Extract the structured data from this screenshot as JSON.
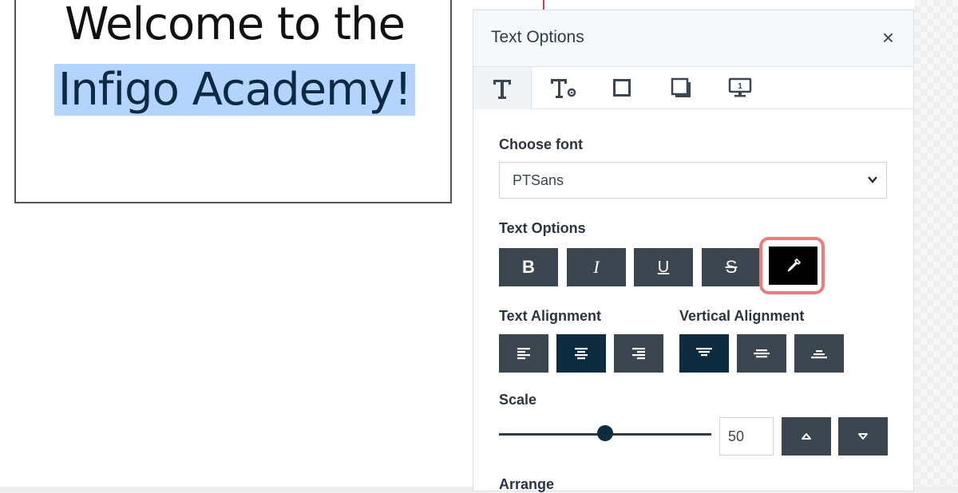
{
  "canvas": {
    "line1": "Welcome to the",
    "line2": "Infigo Academy!"
  },
  "panel": {
    "title": "Text Options",
    "close_label": "×",
    "tabs": [
      {
        "icon": "text-icon"
      },
      {
        "icon": "text-settings-icon"
      },
      {
        "icon": "border-box-icon"
      },
      {
        "icon": "shadow-box-icon"
      },
      {
        "icon": "monitor-icon",
        "badge": "1"
      }
    ],
    "font": {
      "label": "Choose font",
      "selected": "PTSans"
    },
    "text_options": {
      "label": "Text Options",
      "bold": "B",
      "italic": "I",
      "underline": "U",
      "strike": "S",
      "color_icon": "eyedropper-icon"
    },
    "text_alignment": {
      "label": "Text Alignment"
    },
    "vertical_alignment": {
      "label": "Vertical Alignment"
    },
    "scale": {
      "label": "Scale",
      "value": "50",
      "slider_fraction": 0.5
    },
    "arrange": {
      "label": "Arrange"
    }
  },
  "colors": {
    "button": "#3b4650",
    "active": "#0d2c40",
    "highlight": "#f07a7a",
    "selection": "#b3d4fc"
  }
}
